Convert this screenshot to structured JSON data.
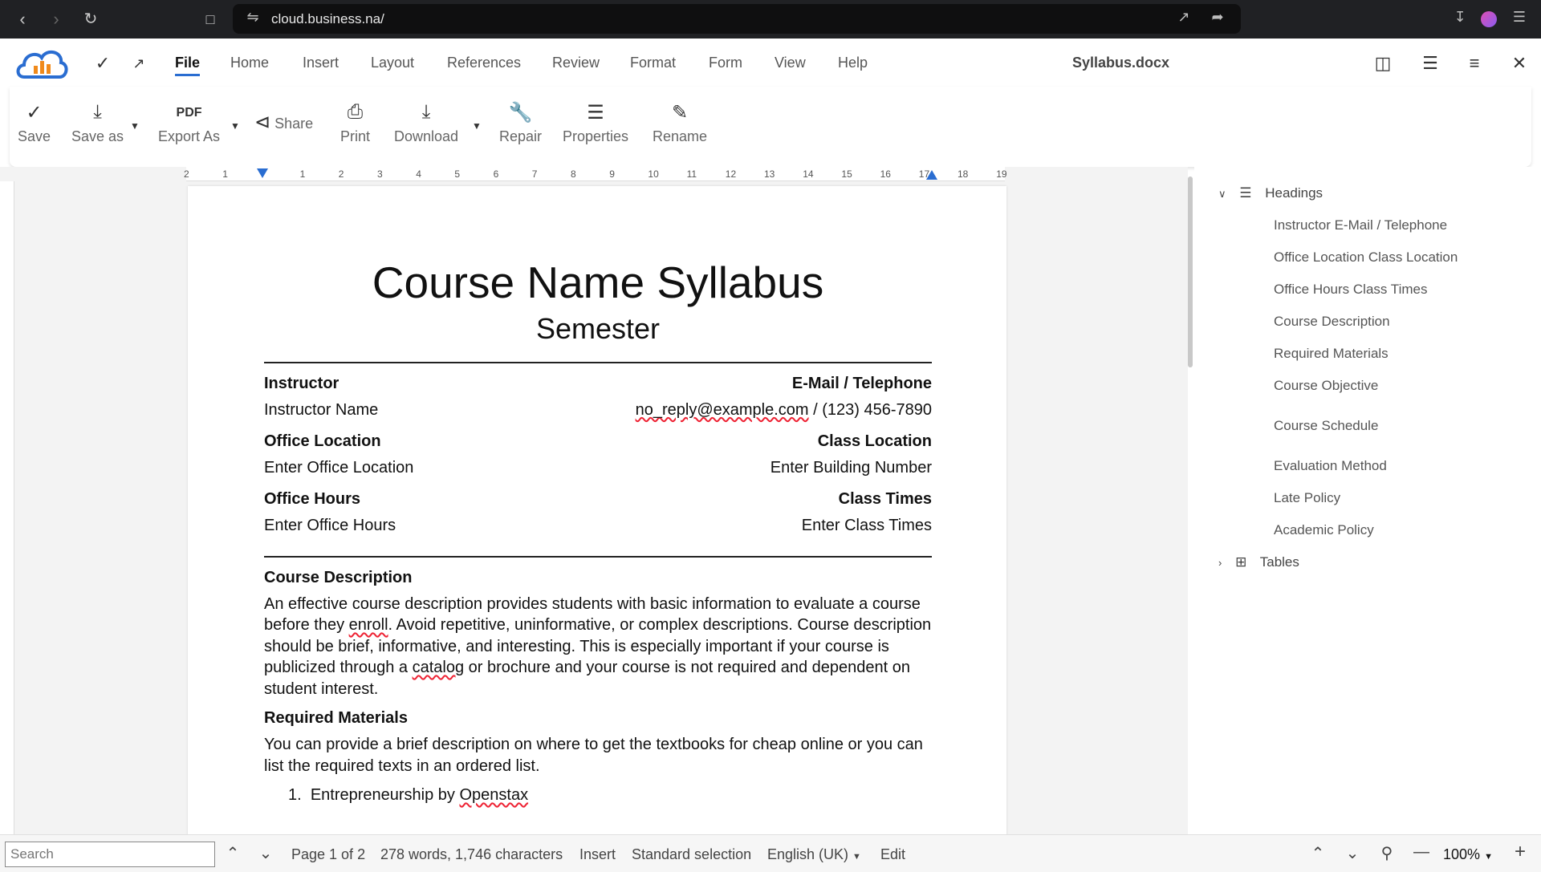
{
  "browser": {
    "url": "cloud.business.na/"
  },
  "app": {
    "document_title": "Syllabus.docx",
    "menu_tabs": [
      "File",
      "Home",
      "Insert",
      "Layout",
      "References",
      "Review",
      "Format",
      "Form",
      "View",
      "Help"
    ],
    "active_tab": "File"
  },
  "toolbar": {
    "save": "Save",
    "save_as": "Save as",
    "export_as": "Export As",
    "share": "Share",
    "print": "Print",
    "download": "Download",
    "repair": "Repair",
    "properties": "Properties",
    "rename": "Rename"
  },
  "ruler": {
    "labels": [
      "2",
      "1",
      "",
      "1",
      "2",
      "3",
      "4",
      "5",
      "6",
      "7",
      "8",
      "9",
      "10",
      "11",
      "12",
      "13",
      "14",
      "15",
      "16",
      "17",
      "18",
      "19"
    ]
  },
  "document": {
    "title": "Course Name Syllabus",
    "subtitle": "Semester",
    "instructor_label": "Instructor",
    "email_label": "E-Mail / Telephone",
    "instructor_value": "Instructor Name",
    "email_value": "no_reply@example.com",
    "phone_value": " / (123) 456-7890",
    "office_location_label": "Office Location",
    "class_location_label": "Class Location",
    "office_location_value": "Enter Office Location",
    "class_location_value": "Enter Building Number",
    "office_hours_label": "Office Hours",
    "class_times_label": "Class Times",
    "office_hours_value": "Enter Office Hours",
    "class_times_value": "Enter Class Times",
    "course_description_heading": "Course Description",
    "course_description_1": "An effective course description provides students with basic information to evaluate a course before they ",
    "course_description_enroll": "enroll",
    "course_description_2": ". Avoid repetitive, uninformative, or complex descriptions. Course description should be brief, informative, and interesting. This is especially important if your course is publicized through a ",
    "course_description_catalog": "catalog",
    "course_description_3": " or brochure and your course is not required and dependent on student interest.",
    "required_materials_heading": "Required Materials",
    "required_materials_text": "You can provide a brief description on where to get the textbooks for cheap online or you can list the required texts in an ordered list.",
    "list_1_num": "1.",
    "list_1_text": "Entrepreneurship by ",
    "list_1_spell": "Openstax"
  },
  "navigator": {
    "headings_label": "Headings",
    "items": [
      "Instructor E-Mail / Telephone",
      "Office Location Class Location",
      "Office Hours Class Times",
      "Course Description",
      "Required Materials",
      "Course Objective",
      "Course Schedule",
      "Evaluation Method",
      "Late Policy",
      "Academic Policy"
    ],
    "tables_label": "Tables"
  },
  "status": {
    "search_placeholder": "Search",
    "page": "Page 1 of 2",
    "words": "278 words, 1,746 characters",
    "mode": "Insert",
    "selection": "Standard selection",
    "language": "English (UK)",
    "edit": "Edit",
    "zoom": "100%"
  }
}
